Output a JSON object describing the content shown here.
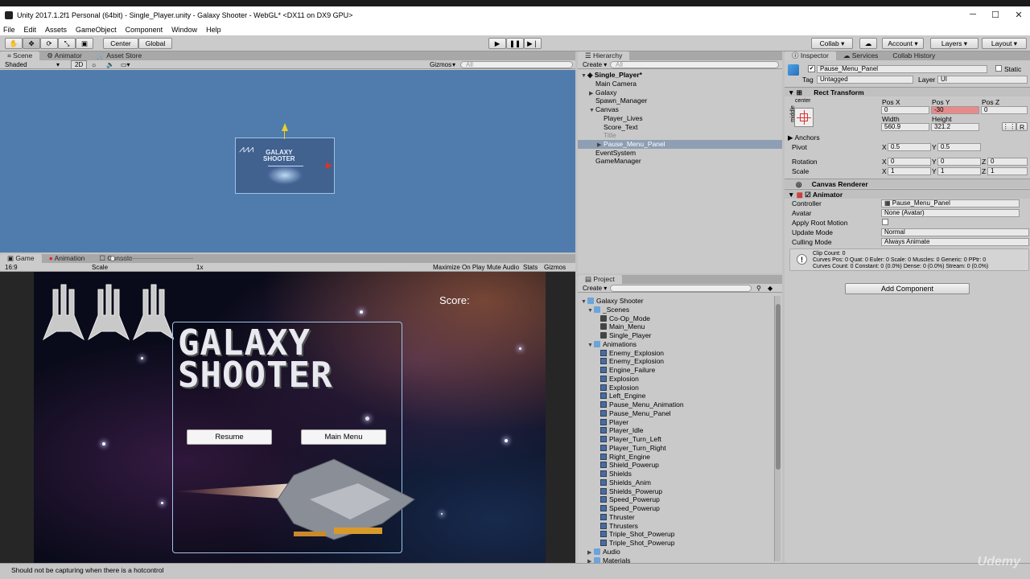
{
  "window": {
    "title": "Unity 2017.1.2f1 Personal (64bit) - Single_Player.unity - Galaxy Shooter - WebGL* <DX11 on DX9 GPU>"
  },
  "menu": [
    "File",
    "Edit",
    "Assets",
    "GameObject",
    "Component",
    "Window",
    "Help"
  ],
  "toolbar": {
    "pivot": "Center",
    "space": "Global",
    "collab": "Collab",
    "account": "Account",
    "layers": "Layers",
    "layout": "Layout"
  },
  "scene": {
    "tabs": [
      "Scene",
      "Animator",
      "Asset Store"
    ],
    "shading": "Shaded",
    "mode2d": "2D",
    "gizmos": "Gizmos",
    "search_placeholder": "All",
    "preview_title_line1": "GALAXY",
    "preview_title_line2": "SHOOTER"
  },
  "game": {
    "tabs": [
      "Game",
      "Animation",
      "Console"
    ],
    "aspect": "16:9",
    "scale_label": "Scale",
    "scale_value": "1x",
    "buttons": [
      "Maximize On Play",
      "Mute Audio",
      "Stats",
      "Gizmos"
    ],
    "score_label": "Score:",
    "title_line1": "GALAXY",
    "title_line2": "SHOOTER",
    "resume": "Resume",
    "main_menu": "Main Menu"
  },
  "hierarchy": {
    "tab": "Hierarchy",
    "create": "Create",
    "search_placeholder": "All",
    "scene": "Single_Player*",
    "items": [
      {
        "label": "Main Camera",
        "indent": 1,
        "arrow": ""
      },
      {
        "label": "Galaxy",
        "indent": 1,
        "arrow": "▶"
      },
      {
        "label": "Spawn_Manager",
        "indent": 1,
        "arrow": ""
      },
      {
        "label": "Canvas",
        "indent": 1,
        "arrow": "▼"
      },
      {
        "label": "Player_Lives",
        "indent": 2,
        "arrow": ""
      },
      {
        "label": "Score_Text",
        "indent": 2,
        "arrow": ""
      },
      {
        "label": "Title",
        "indent": 2,
        "arrow": "",
        "dim": true
      },
      {
        "label": "Pause_Menu_Panel",
        "indent": 2,
        "arrow": "▶",
        "selected": true
      },
      {
        "label": "EventSystem",
        "indent": 1,
        "arrow": ""
      },
      {
        "label": "GameManager",
        "indent": 1,
        "arrow": ""
      }
    ]
  },
  "project": {
    "tab": "Project",
    "create": "Create",
    "root": "Galaxy Shooter",
    "scenes_folder": "_Scenes",
    "scenes": [
      "Co-Op_Mode",
      "Main_Menu",
      "Single_Player"
    ],
    "animations_folder": "Animations",
    "animations": [
      "Enemy_Explosion",
      "Enemy_Explosion",
      "Engine_Failure",
      "Explosion",
      "Explosion",
      "Left_Engine",
      "Pause_Menu_Animation",
      "Pause_Menu_Panel",
      "Player",
      "Player_Idle",
      "Player_Turn_Left",
      "Player_Turn_Right",
      "Right_Engine",
      "Shield_Powerup",
      "Shields",
      "Shields_Anim",
      "Shields_Powerup",
      "Speed_Powerup",
      "Speed_Powerup",
      "Thruster",
      "Thrusters",
      "Triple_Shot_Powerup",
      "Triple_Shot_Powerup"
    ],
    "audio_folder": "Audio",
    "materials_folder": "Materials"
  },
  "inspector": {
    "tabs": [
      "Inspector",
      "Services",
      "Collab History"
    ],
    "object_name": "Pause_Menu_Panel",
    "static": "Static",
    "tag_label": "Tag",
    "tag": "Untagged",
    "layer_label": "Layer",
    "layer": "UI",
    "rect_transform": "Rect Transform",
    "anchor_h": "center",
    "anchor_v": "middle",
    "pos_x_label": "Pos X",
    "pos_y_label": "Pos Y",
    "pos_z_label": "Pos Z",
    "pos_x": "0",
    "pos_y": "-30",
    "pos_z": "0",
    "width_label": "Width",
    "height_label": "Height",
    "width": "560.9",
    "height": "321.2",
    "raw_btn": "R",
    "anchors_label": "Anchors",
    "pivot_label": "Pivot",
    "pivot_x": "0.5",
    "pivot_y": "0.5",
    "rotation_label": "Rotation",
    "rot_x": "0",
    "rot_y": "0",
    "rot_z": "0",
    "scale_label": "Scale",
    "scale_x": "1",
    "scale_y": "1",
    "scale_z": "1",
    "axis_x": "X",
    "axis_y": "Y",
    "axis_z": "Z",
    "canvas_renderer": "Canvas Renderer",
    "animator": "Animator",
    "controller_label": "Controller",
    "controller": "Pause_Menu_Panel",
    "avatar_label": "Avatar",
    "avatar": "None (Avatar)",
    "root_motion_label": "Apply Root Motion",
    "update_mode_label": "Update Mode",
    "update_mode": "Normal",
    "culling_mode_label": "Culling Mode",
    "culling_mode": "Always Animate",
    "info_line1": "Clip Count: 0",
    "info_line2": "Curves Pos: 0 Quat: 0 Euler: 0 Scale: 0 Muscles: 0 Generic: 0 PPtr: 0",
    "info_line3": "Curves Count: 0 Constant: 0 (0.0%) Dense: 0 (0.0%) Stream: 0 (0.0%)",
    "add_component": "Add Component"
  },
  "status": "Should not be capturing when there is a hotcontrol",
  "watermark": "Udemy"
}
